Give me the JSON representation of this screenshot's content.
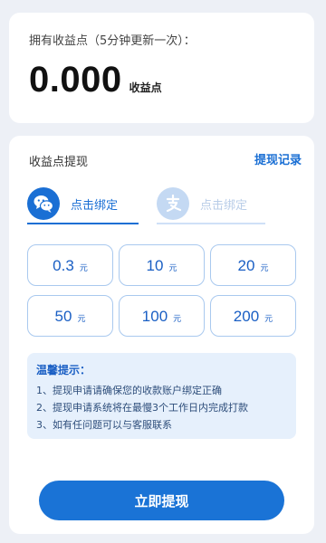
{
  "balance": {
    "label": "拥有收益点（5分钟更新一次）：",
    "value": "0.000",
    "unit": "收益点"
  },
  "withdraw": {
    "title": "收益点提现",
    "record_link": "提现记录",
    "bind_wechat": "点击绑定",
    "bind_alipay": "点击绑定",
    "amounts": [
      {
        "value": "0.3",
        "unit": "元"
      },
      {
        "value": "10",
        "unit": "元"
      },
      {
        "value": "20",
        "unit": "元"
      },
      {
        "value": "50",
        "unit": "元"
      },
      {
        "value": "100",
        "unit": "元"
      },
      {
        "value": "200",
        "unit": "元"
      }
    ],
    "tips": {
      "title": "温馨提示：",
      "lines": [
        "1、提现申请请确保您的收款账户绑定正确",
        "2、提现申请系统将在最慢3个工作日内完成打款",
        "3、如有任问题可以与客服联系"
      ]
    },
    "submit_label": "立即提现"
  },
  "colors": {
    "accent": "#1a73d6",
    "background": "#edf0f6"
  },
  "icons": {
    "wechat": "wechat-icon",
    "alipay": "alipay-icon"
  }
}
